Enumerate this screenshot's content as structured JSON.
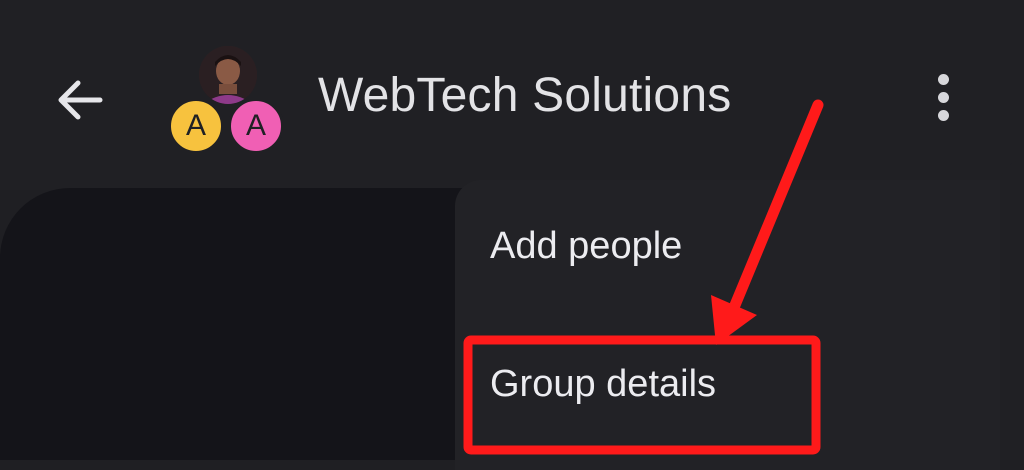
{
  "header": {
    "title": "WebTech Solutions",
    "back_icon": "arrow-left-icon",
    "more_icon": "more-vertical-icon",
    "avatars": [
      {
        "type": "photo",
        "color": "#3b2a2a"
      },
      {
        "type": "letter",
        "letter": "A",
        "color": "#f7c23e"
      },
      {
        "type": "letter",
        "letter": "A",
        "color": "#f05fb4"
      }
    ]
  },
  "menu": {
    "items": [
      {
        "label": "Add people"
      },
      {
        "label": "Group details"
      }
    ]
  },
  "annotation": {
    "color": "#ff1a1a",
    "highlighted_item": "Group details"
  }
}
